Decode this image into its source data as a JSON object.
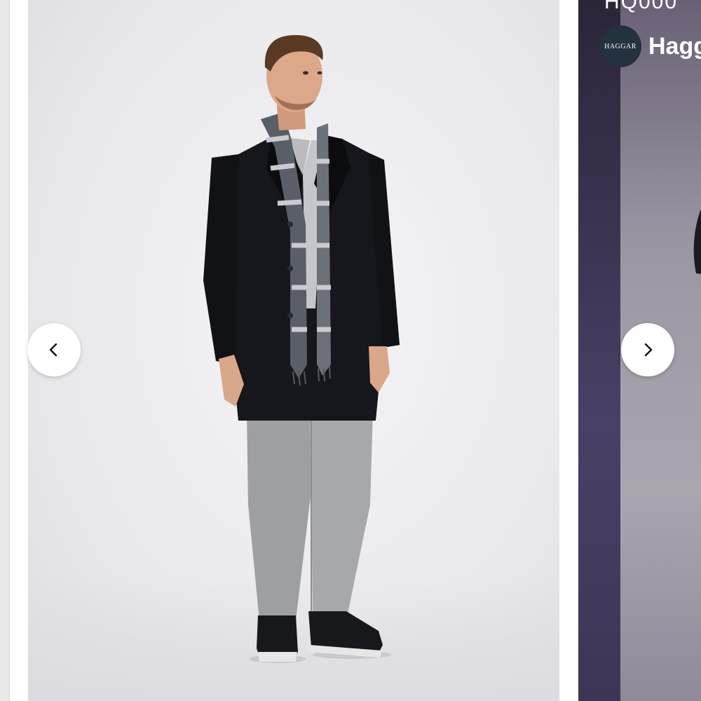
{
  "carousel": {
    "next_card": {
      "top_text": "HQ000",
      "creator": {
        "avatar_text": "HAGGAR",
        "avatar_icon": "haggar-logo-avatar",
        "name": "Hagg"
      }
    },
    "prev_button": {
      "icon": "chevron-left-icon"
    },
    "next_button": {
      "icon": "chevron-right-icon"
    }
  },
  "colors": {
    "main_background": "#ebebee",
    "next_card_background": "#3b3352",
    "avatar_background": "#24313f",
    "nav_button_background": "#ffffff"
  }
}
